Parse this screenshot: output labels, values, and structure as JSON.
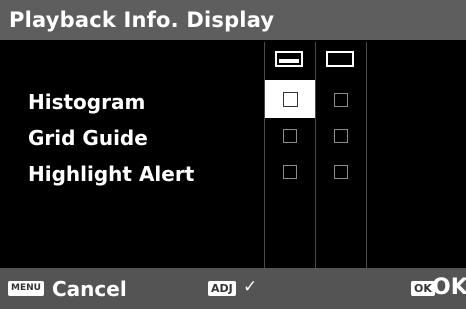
{
  "title": "Playback Info. Display",
  "rows": [
    {
      "label": "Histogram",
      "col1_checked": false,
      "col2_checked": false
    },
    {
      "label": "Grid Guide",
      "col1_checked": false,
      "col2_checked": false
    },
    {
      "label": "Highlight Alert",
      "col1_checked": false,
      "col2_checked": false
    }
  ],
  "columns": [
    {
      "icon": "standard-display-icon"
    },
    {
      "icon": "no-info-display-icon"
    }
  ],
  "footer": {
    "menu_key": "MENU",
    "cancel_label": "Cancel",
    "adj_key": "ADJ",
    "adj_glyph": "✓",
    "ok_key": "OK",
    "ok_label": "OK"
  },
  "colors": {
    "title_bar": "#5e5e5e",
    "bottom_bar": "#545454",
    "selection": "#ffffff"
  }
}
